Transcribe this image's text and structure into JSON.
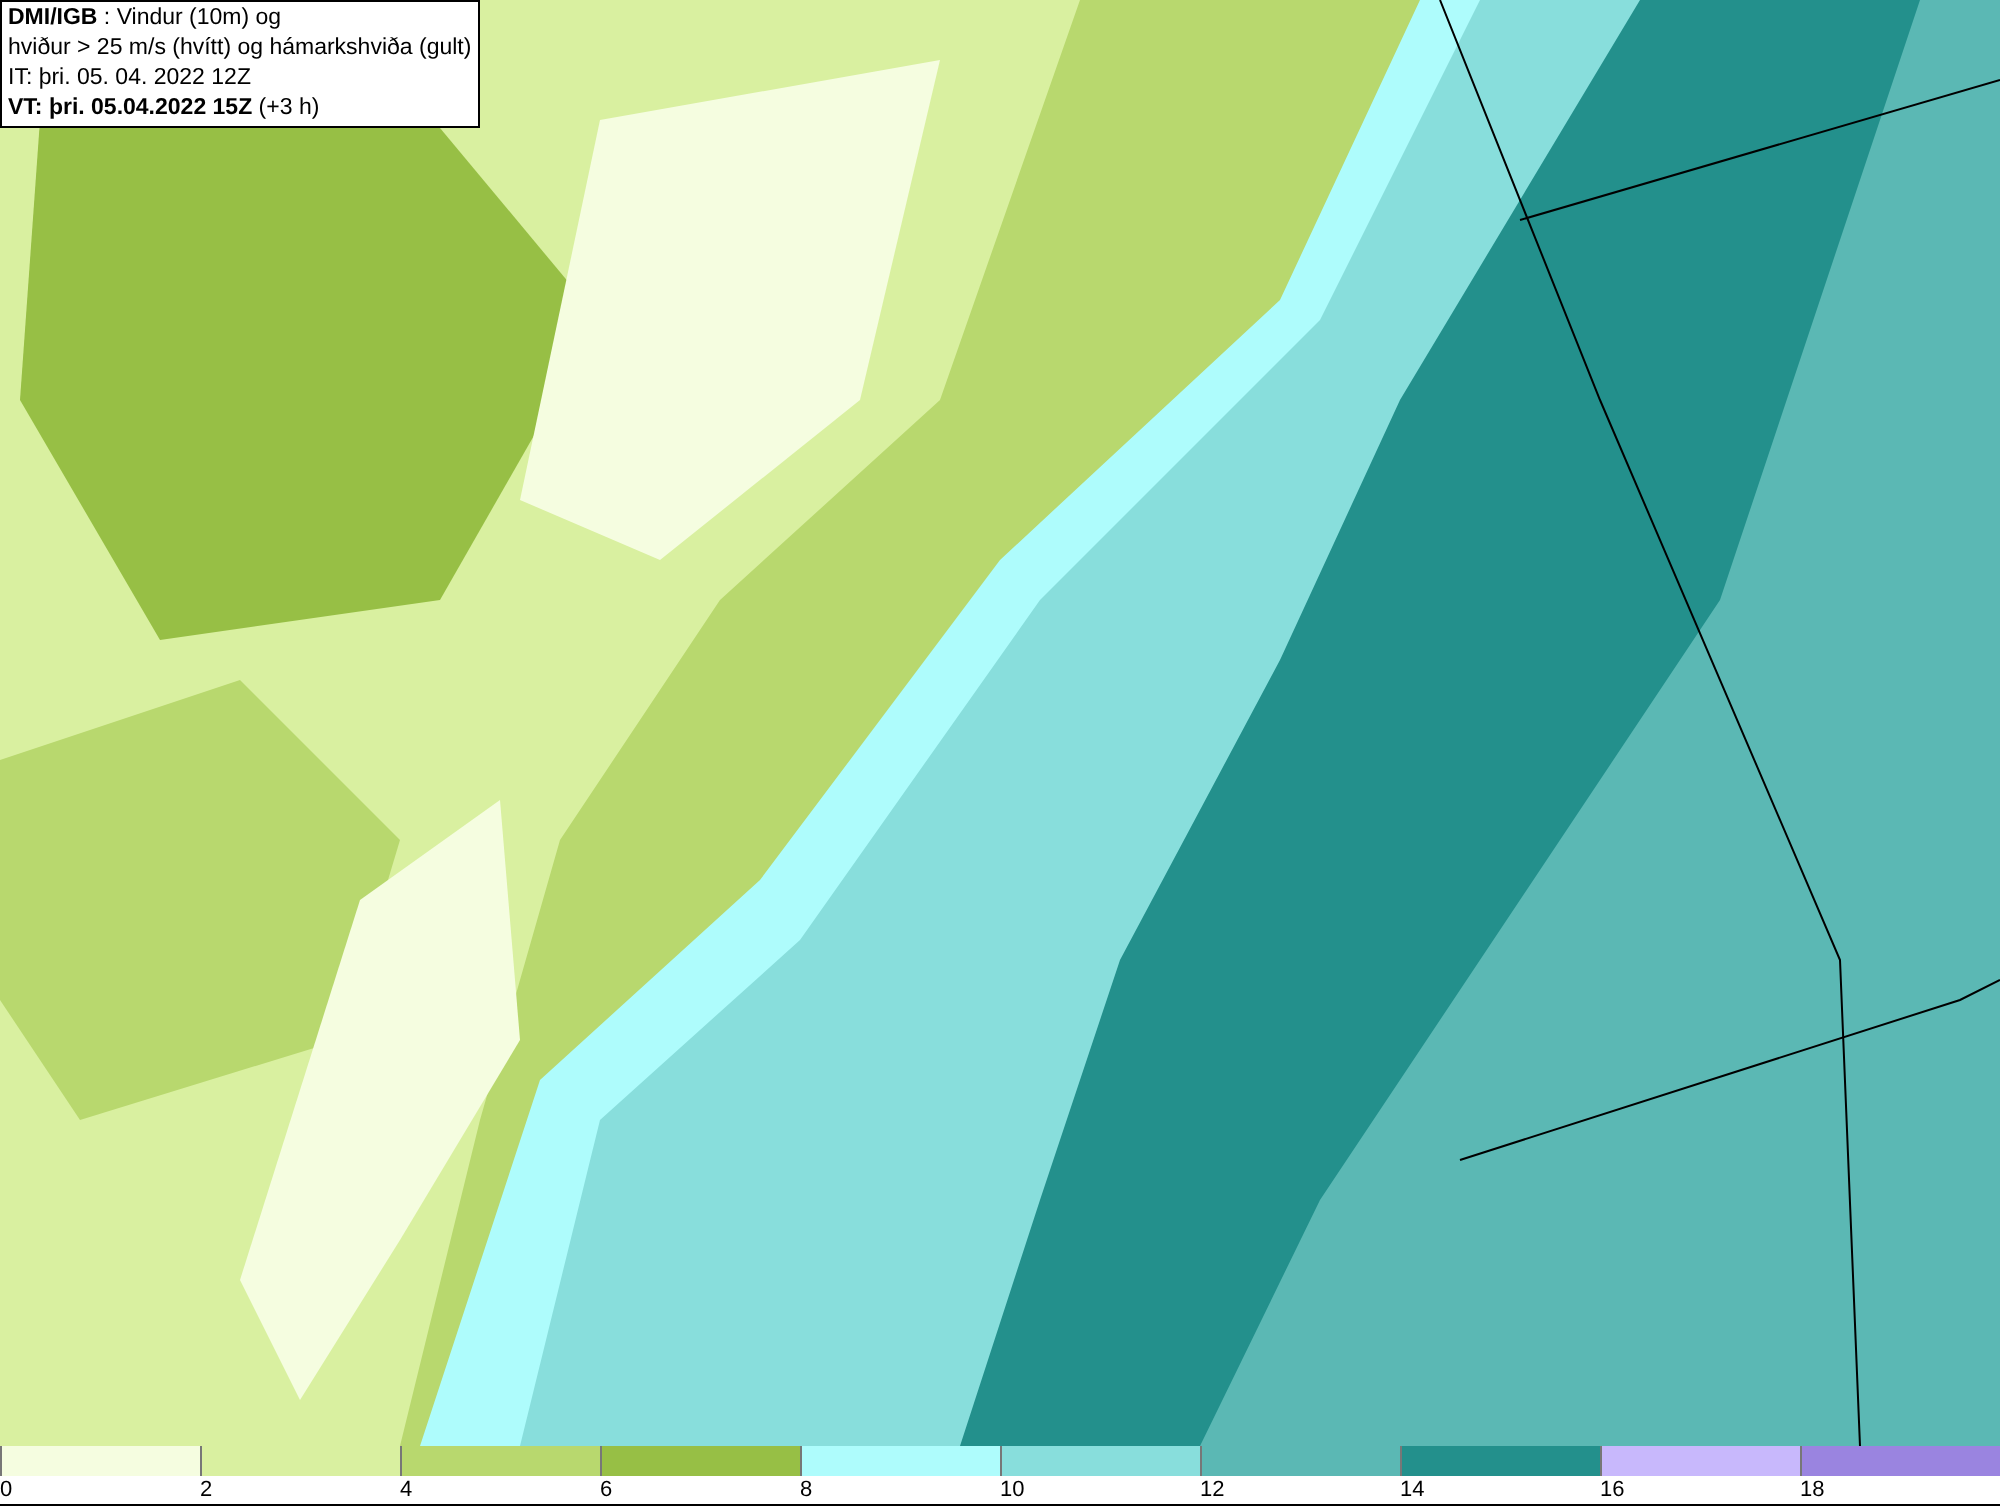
{
  "header": {
    "lines": [
      "**DMI/IGB** : Vindur (10m) og",
      "hviður > 25 m/s (hvítt) og hámarkshviða (gult)",
      "IT: þri. 05. 04. 2022 12Z",
      "**VT: þri. 05.04.2022 15Z** (+3 h)"
    ]
  },
  "legend": [
    {
      "label": "0",
      "color": "#f5fde0"
    },
    {
      "label": "2",
      "color": "#d9f0a0"
    },
    {
      "label": "4",
      "color": "#b8d86e"
    },
    {
      "label": "6",
      "color": "#97bf45"
    },
    {
      "label": "8",
      "color": "#aefcfc"
    },
    {
      "label": "10",
      "color": "#88dedc"
    },
    {
      "label": "12",
      "color": "#5bb8b4"
    },
    {
      "label": "14",
      "color": "#23908c"
    },
    {
      "label": "16",
      "color": "#c8b8fc"
    },
    {
      "label": "18",
      "color": "#9a84e0"
    }
  ]
}
